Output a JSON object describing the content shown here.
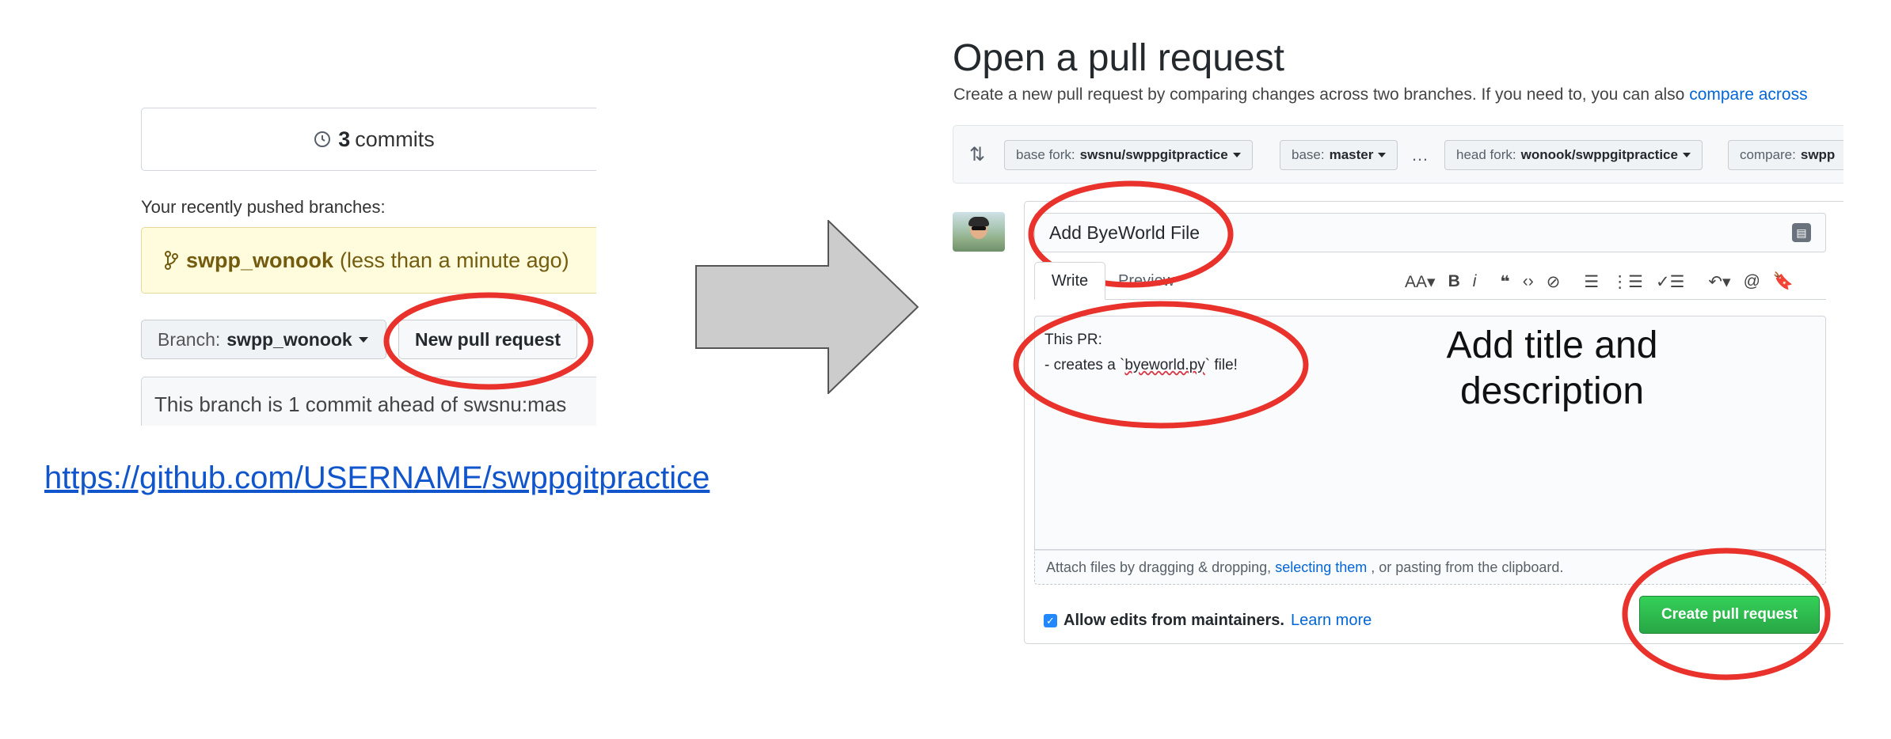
{
  "left": {
    "commits_count": "3",
    "commits_label": "commits",
    "recent_branches_label": "Your recently pushed branches:",
    "pushed_branch_name": "swpp_wonook",
    "pushed_branch_time": "(less than a minute ago)",
    "branch_selector_prefix": "Branch:",
    "branch_selector_value": "swpp_wonook",
    "new_pr_button": "New pull request",
    "ahead_notice": "This branch is 1 commit ahead of swsnu:mas"
  },
  "repo_url": "https://github.com/USERNAME/swppgitpractice",
  "right": {
    "title": "Open a pull request",
    "subtitle_text": "Create a new pull request by comparing changes across two branches. If you need to, you can also ",
    "subtitle_link": "compare across",
    "base_fork_label": "base fork:",
    "base_fork_value": "swsnu/swppgitpractice",
    "base_label": "base:",
    "base_value": "master",
    "dots": "…",
    "head_fork_label": "head fork:",
    "head_fork_value": "wonook/swppgitpractice",
    "compare_label": "compare:",
    "compare_value": "swpp",
    "pr_title_value": "Add ByeWorld File",
    "tab_write": "Write",
    "tab_preview": "Preview",
    "toolbar": [
      "AA▾",
      "B",
      "i",
      "❝",
      "‹›",
      "⊘",
      "☰",
      "⋮☰",
      "✓☰",
      "↶▾",
      "@",
      "🔖"
    ],
    "description_line1": "This PR:",
    "description_line2_pre": "- creates a `",
    "description_line2_word": "byeworld.py",
    "description_line2_post": "` file!",
    "attach_pre": "Attach files by dragging & dropping,",
    "attach_link": "selecting them",
    "attach_post": ", or pasting from the clipboard.",
    "allow_edits_label": "Allow edits from maintainers.",
    "learn_more": "Learn more",
    "create_pr_button": "Create pull request"
  },
  "annotation": {
    "line1": "Add title and",
    "line2": "description"
  },
  "colors": {
    "highlight": "#e8322b",
    "link": "#0366d6",
    "green_button": "#28a745"
  }
}
